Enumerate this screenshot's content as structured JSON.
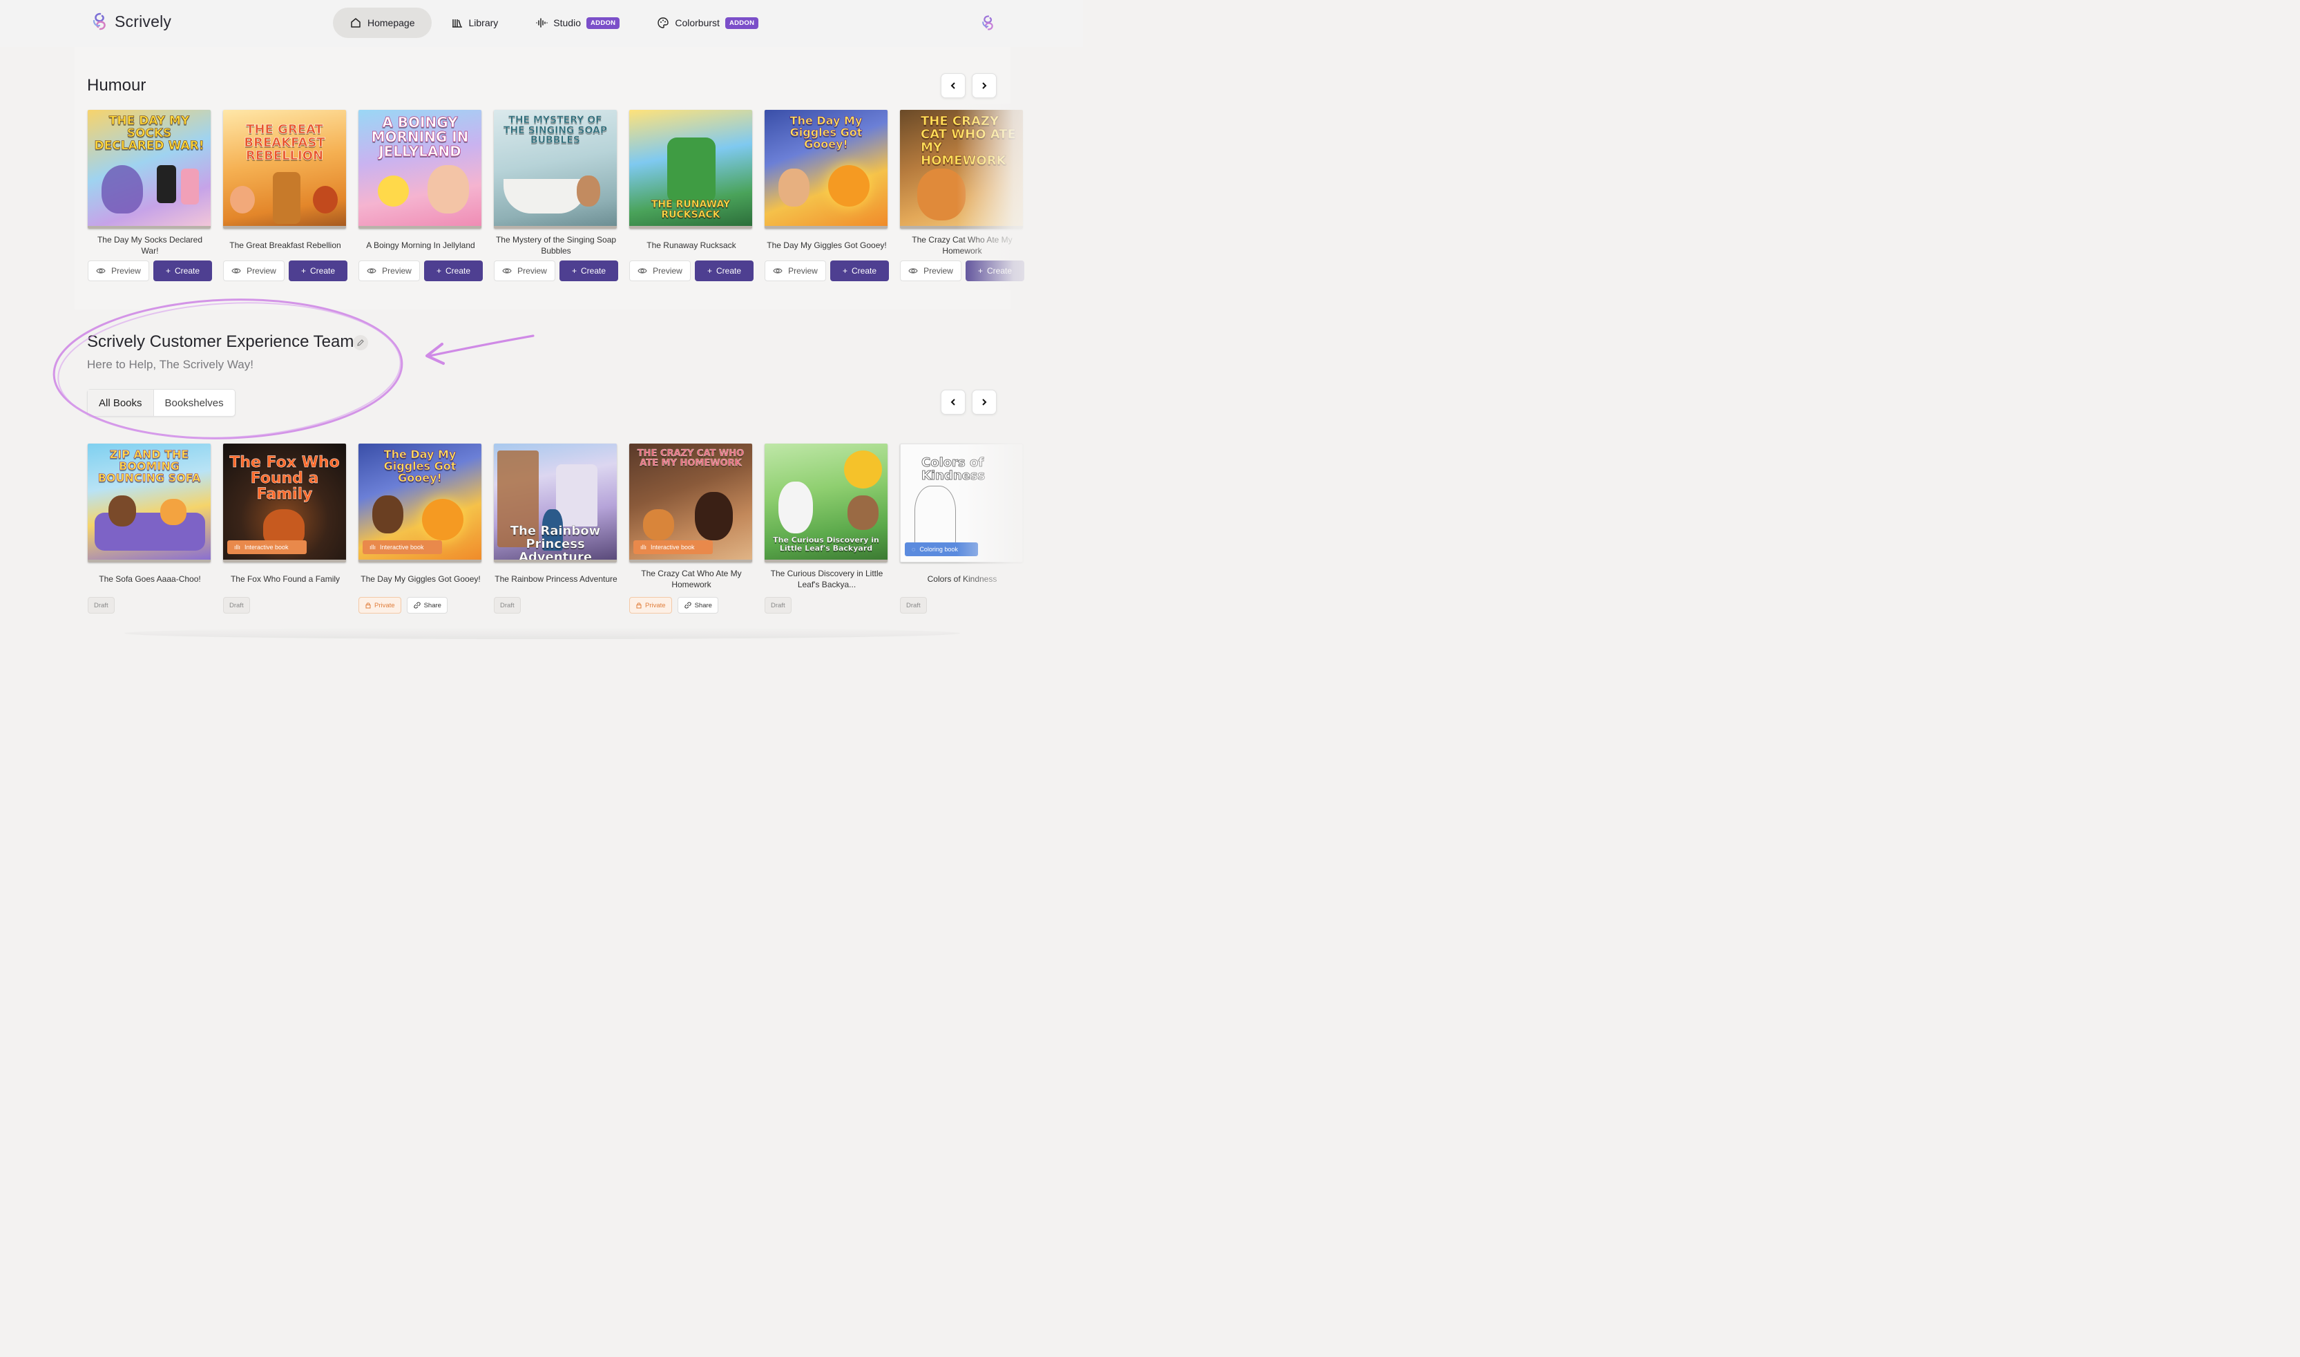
{
  "brand": {
    "name": "Scrively"
  },
  "nav": [
    {
      "label": "Homepage",
      "icon": "home-icon",
      "active": true
    },
    {
      "label": "Library",
      "icon": "library-icon",
      "active": false
    },
    {
      "label": "Studio",
      "icon": "waveform-icon",
      "badge": "ADDON",
      "active": false
    },
    {
      "label": "Colorburst",
      "icon": "palette-icon",
      "badge": "ADDON",
      "active": false
    }
  ],
  "humour": {
    "title": "Humour",
    "preview_label": "Preview",
    "create_label": "Create",
    "books": [
      {
        "title": "The Day My Socks Declared War!",
        "cover_text": "THE DAY MY SOCKS DECLARED WAR!"
      },
      {
        "title": "The Great Breakfast Rebellion",
        "cover_text": "THE GREAT BREAKFAST REBELLION"
      },
      {
        "title": "A Boingy Morning In Jellyland",
        "cover_text": "A BOINGY MORNING IN JELLYLAND"
      },
      {
        "title": "The Mystery of the Singing Soap Bubbles",
        "cover_text": "THE MYSTERY OF THE SINGING SOAP BUBBLES"
      },
      {
        "title": "The Runaway Rucksack",
        "cover_text": "THE RUNAWAY RUCKSACK"
      },
      {
        "title": "The Day My Giggles Got Gooey!",
        "cover_text": "The Day My Giggles Got Gooey!"
      },
      {
        "title": "The Crazy Cat Who Ate My Homework",
        "cover_text": "THE CRAZY CAT WHO ATE MY HOMEWORK"
      }
    ]
  },
  "team": {
    "title": "Scrively Customer Experience Team",
    "subtitle": "Here to Help, The Scrively Way!",
    "tabs": [
      {
        "label": "All Books",
        "active": true
      },
      {
        "label": "Bookshelves",
        "active": false
      }
    ],
    "books": [
      {
        "title": "The Sofa Goes Aaaa-Choo!",
        "cover_text": "ZIP AND THE BOOMING BOUNCING SOFA",
        "tag": "",
        "status": [
          "Draft"
        ]
      },
      {
        "title": "The Fox Who Found a Family",
        "cover_text": "The Fox Who Found a Family",
        "tag": "Interactive book",
        "status": [
          "Draft"
        ]
      },
      {
        "title": "The Day My Giggles Got Gooey!",
        "cover_text": "The Day My Giggles Got Gooey!",
        "tag": "Interactive book",
        "status": [
          "Private",
          "Share"
        ]
      },
      {
        "title": "The Rainbow Princess Adventure",
        "cover_text": "The Rainbow Princess Adventure",
        "tag": "",
        "status": [
          "Draft"
        ]
      },
      {
        "title": "The Crazy Cat Who Ate My Homework",
        "cover_text": "THE CRAZY CAT WHO ATE MY HOMEWORK",
        "tag": "Interactive book",
        "status": [
          "Private",
          "Share"
        ]
      },
      {
        "title": "The Curious Discovery in Little Leaf's Backya...",
        "cover_text": "The Curious Discovery in Little Leaf's Backyard",
        "tag": "",
        "status": [
          "Draft"
        ]
      },
      {
        "title": "Colors of Kindness",
        "cover_text": "Colors of Kindness",
        "tag": "Coloring book",
        "status": [
          "Draft"
        ]
      }
    ]
  },
  "colors": {
    "accent": "#4e3f91",
    "addon": "#7b4fc9",
    "annotation": "#cf8ae6",
    "interactive": "#e9894b",
    "coloring": "#5b8bde"
  }
}
